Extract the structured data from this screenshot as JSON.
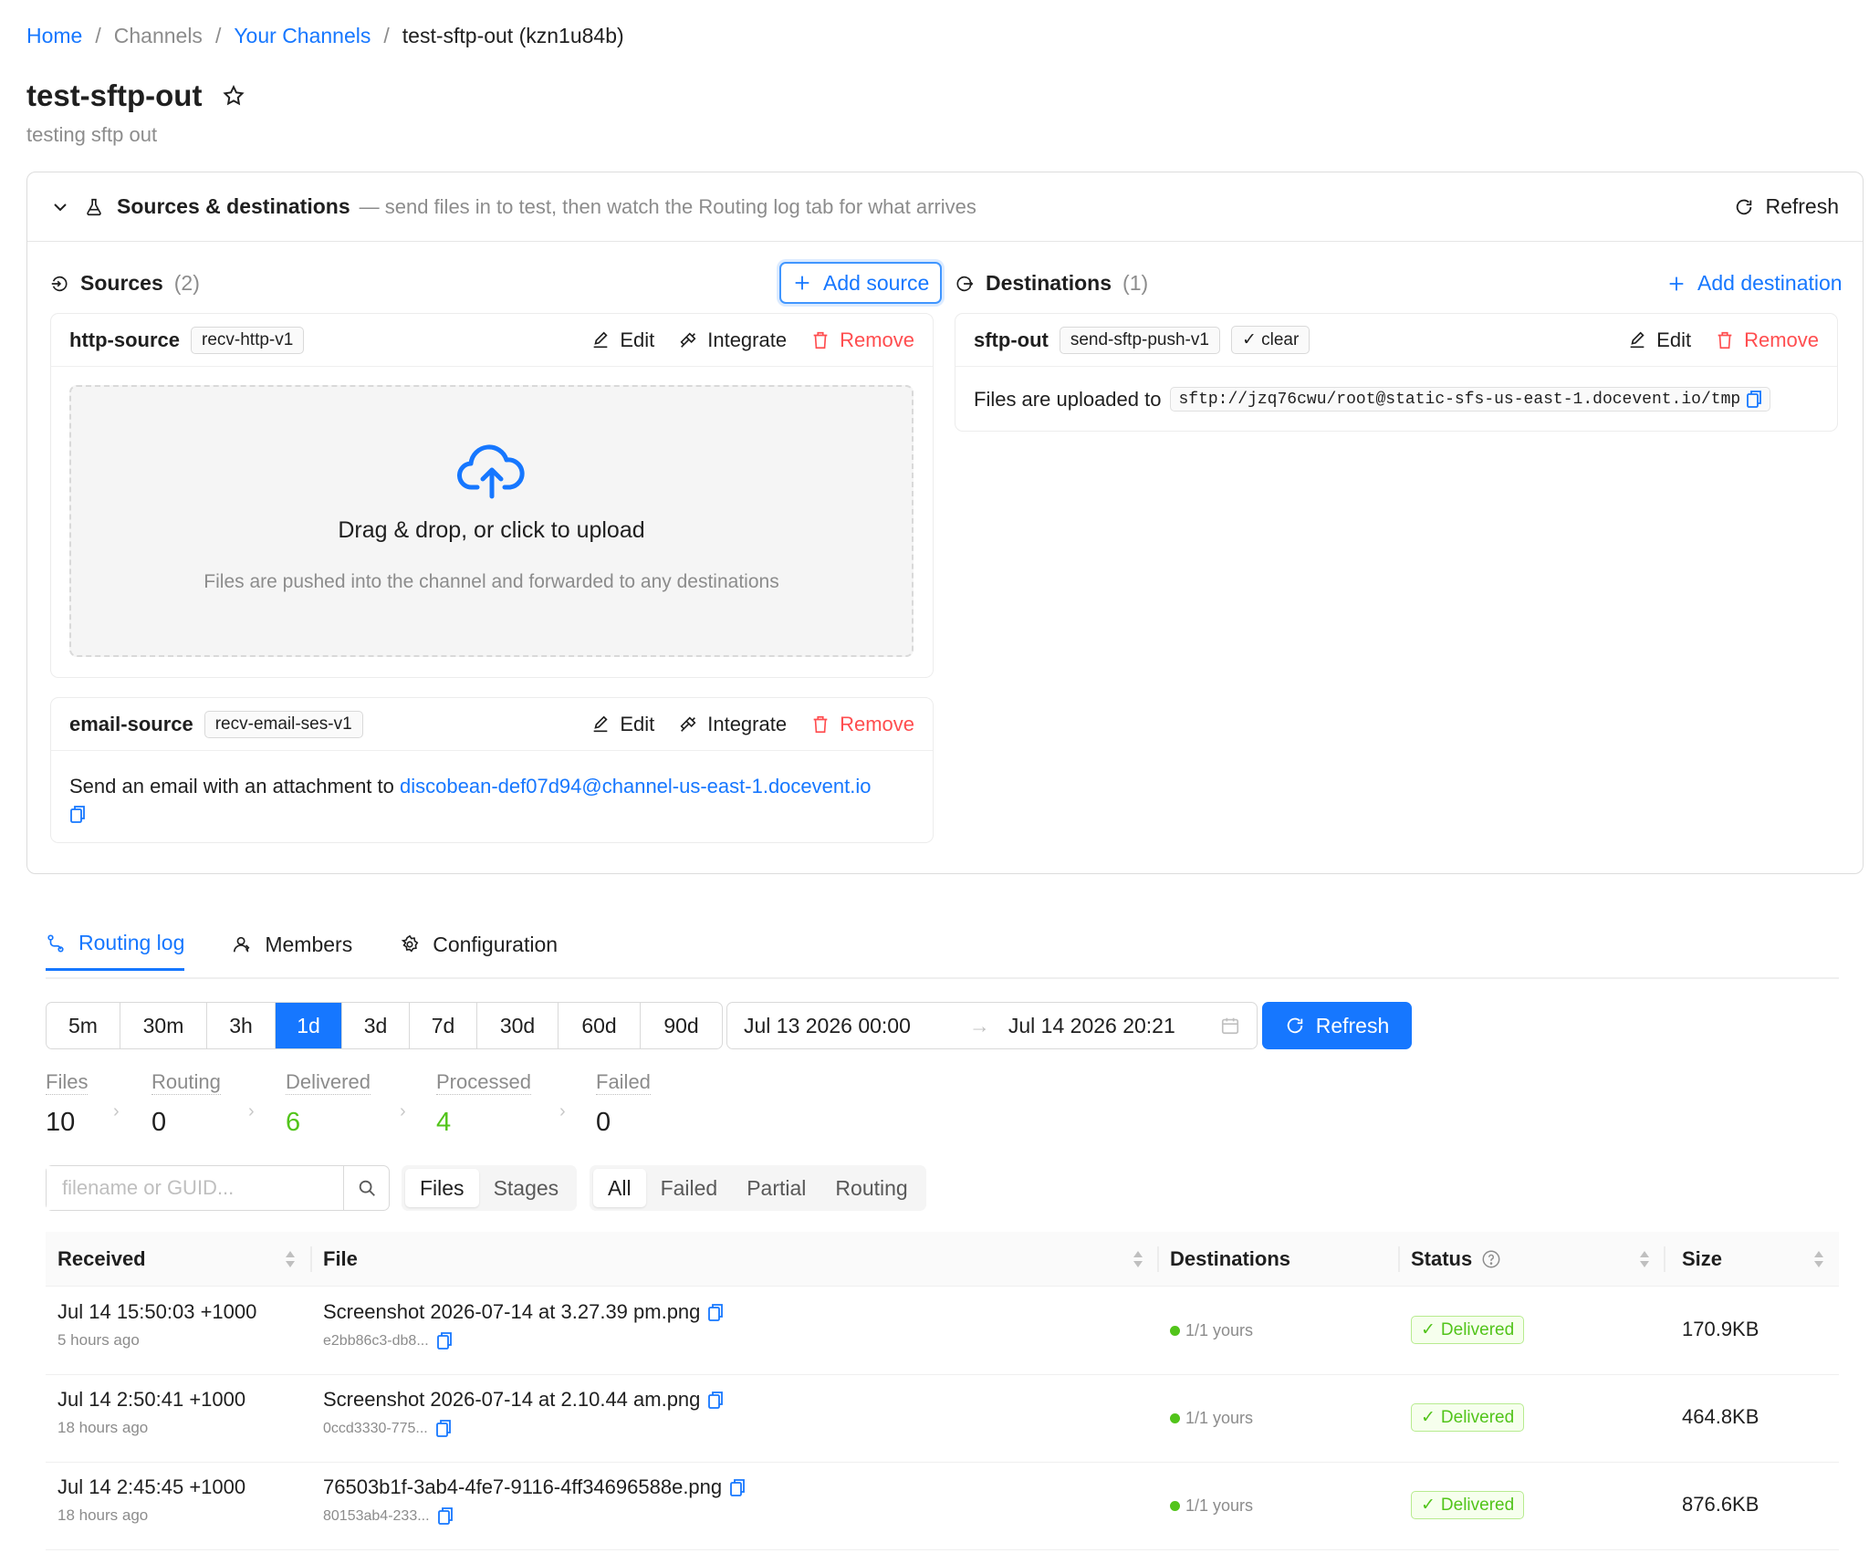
{
  "breadcrumb": {
    "home": "Home",
    "channels": "Channels",
    "your_channels": "Your Channels",
    "current": "test-sftp-out (kzn1u84b)",
    "separator": "/"
  },
  "channel": {
    "title": "test-sftp-out",
    "description": "testing sftp out"
  },
  "panel": {
    "title": "Sources & destinations",
    "description": "— send files in to test, then watch the Routing log tab for what arrives",
    "refresh_label": "Refresh"
  },
  "sources": {
    "label": "Sources",
    "count": "(2)",
    "add_label": "Add source",
    "items": [
      {
        "name": "http-source",
        "tag": "recv-http-v1",
        "edit": "Edit",
        "integrate": "Integrate",
        "remove": "Remove",
        "upload_title": "Drag & drop, or click to upload",
        "upload_hint": "Files are pushed into the channel and forwarded to any destinations"
      },
      {
        "name": "email-source",
        "tag": "recv-email-ses-v1",
        "edit": "Edit",
        "integrate": "Integrate",
        "remove": "Remove",
        "text": "Send an email with an attachment to",
        "email": "discobean-def07d94@channel-us-east-1.docevent.io"
      }
    ]
  },
  "destinations": {
    "label": "Destinations",
    "count": "(1)",
    "add_label": "Add destination",
    "items": [
      {
        "name": "sftp-out",
        "tag": "send-sftp-push-v1",
        "status_tag": "clear",
        "edit": "Edit",
        "remove": "Remove",
        "text": "Files are uploaded to",
        "url": "sftp://jzq76cwu/root@static-sfs-us-east-1.docevent.io/tmp"
      }
    ]
  },
  "tabs": [
    "Routing log",
    "Members",
    "Configuration"
  ],
  "active_tab": "Routing log",
  "time_ranges": [
    "5m",
    "30m",
    "3h",
    "1d",
    "3d",
    "7d",
    "30d",
    "60d",
    "90d"
  ],
  "selected_range": "1d",
  "date_range": {
    "start": "Jul 13 2026 00:00",
    "end": "Jul 14 2026 20:21"
  },
  "refresh_button": "Refresh",
  "stats": [
    {
      "label": "Files",
      "value": "10"
    },
    {
      "label": "Routing",
      "value": "0"
    },
    {
      "label": "Delivered",
      "value": "6"
    },
    {
      "label": "Processed",
      "value": "4"
    },
    {
      "label": "Failed",
      "value": "0"
    }
  ],
  "search": {
    "placeholder": "filename or GUID..."
  },
  "view_toggle": [
    "Files",
    "Stages"
  ],
  "view_selected": "Files",
  "status_filter": [
    "All",
    "Failed",
    "Partial",
    "Routing"
  ],
  "status_selected": "All",
  "table": {
    "columns": [
      "Received",
      "File",
      "Destinations",
      "Status",
      "Size"
    ],
    "rows": [
      {
        "received": "Jul 14 15:50:03 +1000",
        "ago": "5 hours ago",
        "file": "Screenshot 2026-07-14 at 3.27.39 pm.png",
        "guid": "e2bb86c3-db8...",
        "dest": "1/1 yours",
        "status": "Delivered",
        "size": "170.9KB"
      },
      {
        "received": "Jul 14 2:50:41 +1000",
        "ago": "18 hours ago",
        "file": "Screenshot 2026-07-14 at 2.10.44 am.png",
        "guid": "0ccd3330-775...",
        "dest": "1/1 yours",
        "status": "Delivered",
        "size": "464.8KB"
      },
      {
        "received": "Jul 14 2:45:45 +1000",
        "ago": "18 hours ago",
        "file": "76503b1f-3ab4-4fe7-9116-4ff34696588e.png",
        "guid": "80153ab4-233...",
        "dest": "1/1 yours",
        "status": "Delivered",
        "size": "876.6KB"
      }
    ]
  },
  "colors": {
    "accent": "#1677ff",
    "danger": "#ff4d4f",
    "success": "#52c41a"
  }
}
